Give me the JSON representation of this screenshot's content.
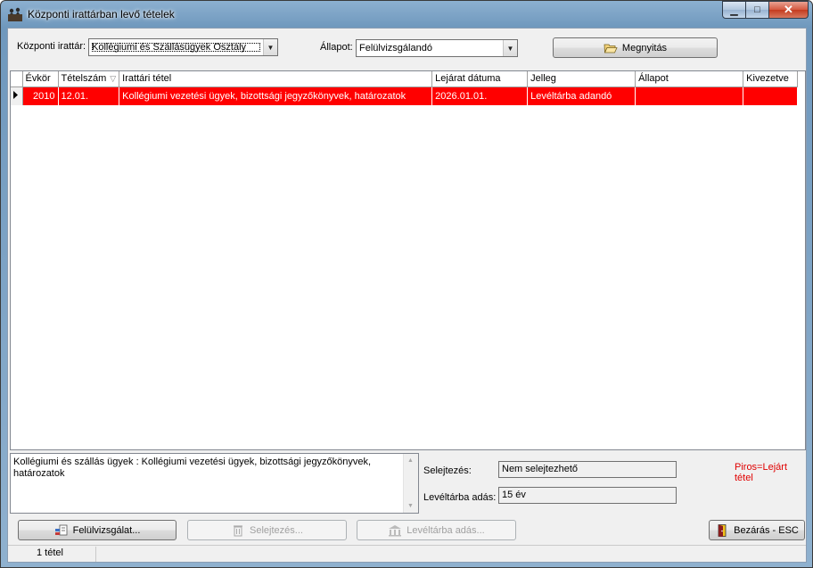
{
  "window": {
    "title": "Központi irattárban levő tételek",
    "icon": "archive-figures-icon"
  },
  "filters": {
    "archive_label": "Központi irattár:",
    "archive_value": "Kollégiumi és Szállásügyek Osztály",
    "state_label": "Állapot:",
    "state_value": "Felülvizsgálandó",
    "open_button": "Megnyitás",
    "open_icon": "folder-open-icon"
  },
  "grid": {
    "columns": [
      "Évkör",
      "Tételszám",
      "Irattári tétel",
      "Lejárat dátuma",
      "Jelleg",
      "Állapot",
      "Kivezetve"
    ],
    "rows": [
      {
        "evkor": "2010",
        "tetelszam": "12.01.",
        "irattari_tetel": "Kollégiumi vezetési ügyek, bizottsági jegyzőkönyvek, határozatok",
        "lejarat": "2026.01.01.",
        "jelleg": "Levéltárba adandó",
        "allapot": "",
        "kivezetve": "",
        "highlight_color": "#ff0000"
      }
    ]
  },
  "details": {
    "memo_text": "Kollégiumi és szállás ügyek : Kollégiumi vezetési ügyek, bizottsági jegyzőkönyvek, határozatok",
    "selejtezes_label": "Selejtezés:",
    "selejtezes_value": "Nem selejtezhető",
    "leveltarba_label": "Levéltárba adás:",
    "leveltarba_value": "15 év",
    "legend": "Piros=Lejárt tétel"
  },
  "buttons": {
    "review": "Felülvizsgálat...",
    "discard": "Selejtezés...",
    "archive": "Levéltárba adás...",
    "close": "Bezárás - ESC"
  },
  "status": {
    "count": "1 tétel"
  },
  "colors": {
    "expired_row": "#ff0000",
    "legend_text": "#e00000",
    "titlebar": "#7fa4c6"
  }
}
